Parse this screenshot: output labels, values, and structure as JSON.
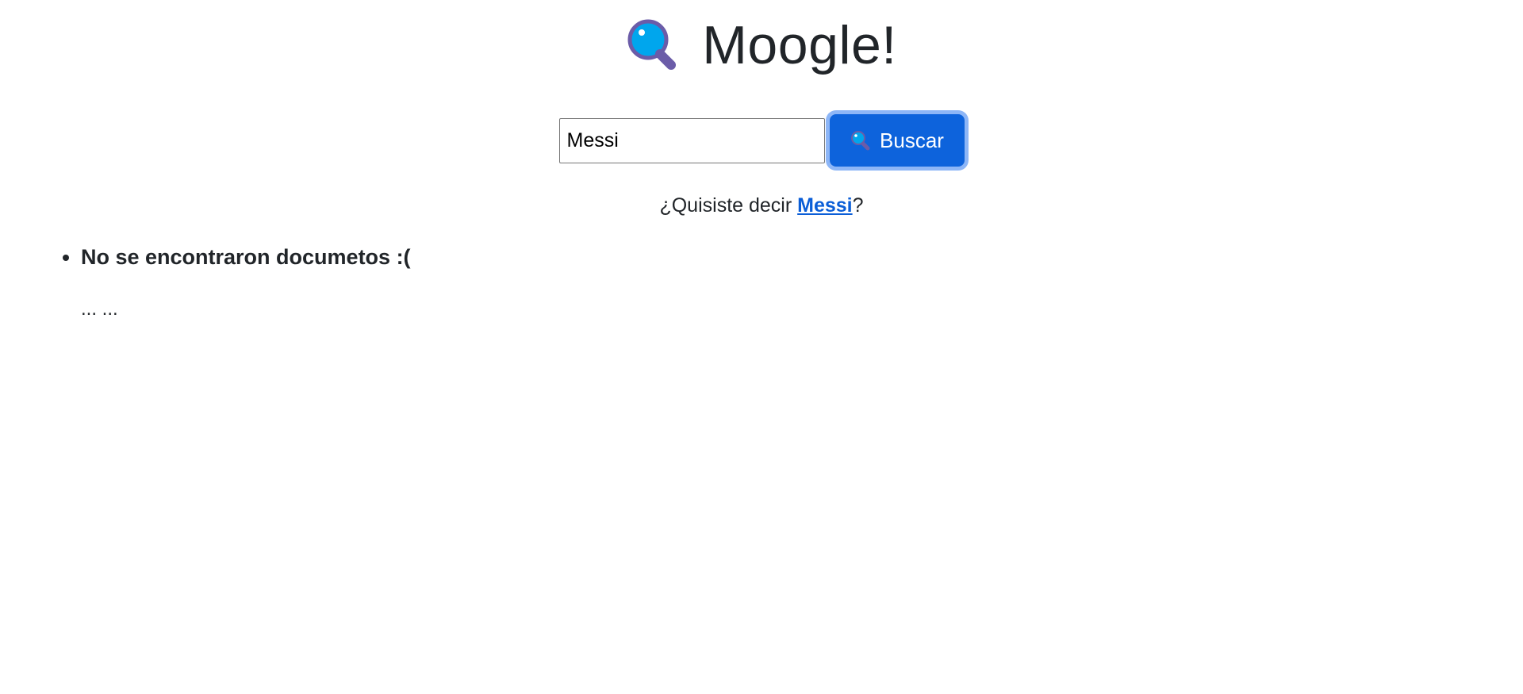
{
  "header": {
    "title": "Moogle!",
    "icon": "magnifying-glass-icon"
  },
  "search": {
    "value": "Messi",
    "button_label": "Buscar",
    "button_icon": "magnifying-glass-icon"
  },
  "suggestion": {
    "prefix": "¿Quisiste decir ",
    "link_text": "Messi",
    "suffix": "?"
  },
  "results": [
    {
      "title": "No se encontraron documetos :(",
      "snippet": "... ..."
    }
  ],
  "colors": {
    "text": "#212529",
    "button": "#0d63dc",
    "link": "#0b5ed7",
    "magnifier_lens": "#00a6ed",
    "magnifier_handle": "#6b5ca8"
  }
}
